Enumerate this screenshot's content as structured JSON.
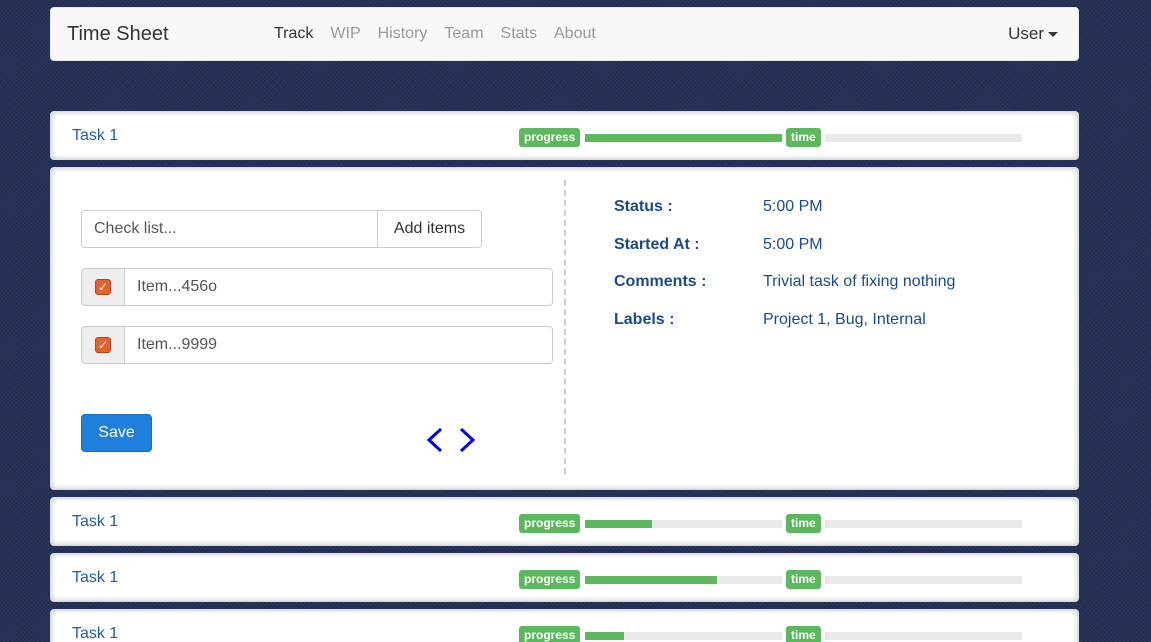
{
  "app": {
    "title": "Time Sheet"
  },
  "nav": {
    "items": [
      {
        "label": "Track",
        "active": true
      },
      {
        "label": "WIP",
        "active": false
      },
      {
        "label": "History",
        "active": false
      },
      {
        "label": "Team",
        "active": false
      },
      {
        "label": "Stats",
        "active": false
      },
      {
        "label": "About",
        "active": false
      }
    ],
    "user_label": "User"
  },
  "tasks": [
    {
      "title": "Task 1",
      "progress_label": "progress",
      "time_label": "time",
      "progress": 1.0,
      "time": 0.0
    },
    {
      "title": "Task 1",
      "progress_label": "progress",
      "time_label": "time",
      "progress": 0.34,
      "time": 0.0
    },
    {
      "title": "Task 1",
      "progress_label": "progress",
      "time_label": "time",
      "progress": 0.67,
      "time": 0.0
    },
    {
      "title": "Task 1",
      "progress_label": "progress",
      "time_label": "time",
      "progress": 0.2,
      "time": 0.0
    }
  ],
  "detail": {
    "checklist_placeholder": "Check list...",
    "add_items_label": "Add items",
    "items": [
      {
        "text": "Item...456o",
        "checked": true
      },
      {
        "text": "Item...9999",
        "checked": true
      }
    ],
    "save_label": "Save",
    "info": [
      {
        "label": "Status :",
        "value": "5:00 PM"
      },
      {
        "label": "Started At :",
        "value": "5:00 PM"
      },
      {
        "label": "Comments :",
        "value": "Trivial task of fixing nothing"
      },
      {
        "label": "Labels :",
        "value": "Project 1, Bug, Internal"
      }
    ]
  },
  "colors": {
    "accent": "#1e7fdc",
    "success": "#5cb85c",
    "checkbox": "#e8612c",
    "arrow": "#0000ff",
    "link": "#1f5ea8"
  },
  "icons": {
    "checkbox": "check-icon",
    "prev": "chevron-left-icon",
    "next": "chevron-right-icon",
    "user_menu": "caret-down-icon"
  }
}
